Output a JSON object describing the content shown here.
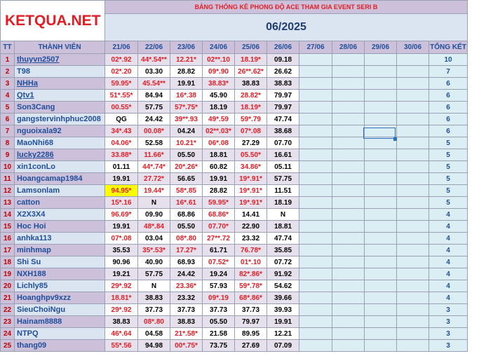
{
  "logo": "KETQUA.NET",
  "title": "BẢNG THỐNG KÊ PHONG ĐỘ ACE THAM GIA EVENT SERI B",
  "period": "06/2025",
  "headers": {
    "tt": "TT",
    "member": "THÀNH VIÊN",
    "dates": [
      "21/06",
      "22/06",
      "23/06",
      "24/06",
      "25/06",
      "26/06",
      "27/06",
      "28/06",
      "29/06",
      "30/06"
    ],
    "total": "TỔNG KẾT"
  },
  "rows": [
    {
      "tt": "1",
      "name": "thuyvn2507",
      "cells": [
        "02*.92",
        "44*.54**",
        "12.21*",
        "02**.10",
        "18.19*",
        "09.18"
      ],
      "total": "10"
    },
    {
      "tt": "2",
      "name": "T98",
      "cells": [
        "02*.20",
        "03.30",
        "28.82",
        "09*.90",
        "26**.62*",
        "26.62"
      ],
      "total": "7"
    },
    {
      "tt": "3",
      "name": "NHHa",
      "cells": [
        "59.95*",
        "45.54**",
        "19.91",
        "38.83*",
        "38.83",
        "38.83"
      ],
      "total": "6"
    },
    {
      "tt": "4",
      "name": "Qtv1",
      "cells": [
        "51*.55*",
        "84.94",
        "16*.38",
        "45.90",
        "28.82*",
        "79.97"
      ],
      "total": "6"
    },
    {
      "tt": "5",
      "name": "Son3Cang",
      "cells": [
        "00.55*",
        "57.75",
        "57*.75*",
        "18.19",
        "18.19*",
        "79.97"
      ],
      "total": "6"
    },
    {
      "tt": "6",
      "name": "gangstervinhphuc2008",
      "cells": [
        "QG",
        "24.42",
        "39**.93",
        "49*.59",
        "59*.79",
        "47.74"
      ],
      "total": "6"
    },
    {
      "tt": "7",
      "name": "nguoixala92",
      "cells": [
        "34*.43",
        "00.08*",
        "04.24",
        "02**.03*",
        "07*.08",
        "38.68"
      ],
      "total": "6"
    },
    {
      "tt": "8",
      "name": "MaoNhi68",
      "cells": [
        "04.06*",
        "52.58",
        "10.21*",
        "06*.08",
        "27.29",
        "07.70"
      ],
      "total": "5"
    },
    {
      "tt": "9",
      "name": "lucky2286",
      "cells": [
        "33.88*",
        "11.66*",
        "05.50",
        "18.81",
        "05.50*",
        "16.61"
      ],
      "total": "5"
    },
    {
      "tt": "10",
      "name": "xin1conLo",
      "cells": [
        "01.11",
        "44*.74*",
        "20*.26*",
        "60.82",
        "34.86*",
        "05.11"
      ],
      "total": "5"
    },
    {
      "tt": "11",
      "name": "Hoangcamap1984",
      "cells": [
        "19.91",
        "27.72*",
        "56.65",
        "19.91",
        "19*.91*",
        "57.75"
      ],
      "total": "5"
    },
    {
      "tt": "12",
      "name": "Lamsonlam",
      "cells": [
        "94.95*",
        "19.44*",
        "58*.85",
        "28.82",
        "19*.91*",
        "11.51"
      ],
      "total": "5"
    },
    {
      "tt": "13",
      "name": "catton",
      "cells": [
        "15*.16",
        "N",
        "16*.61",
        "59.95*",
        "19*.91*",
        "18.19"
      ],
      "total": "5"
    },
    {
      "tt": "14",
      "name": "X2X3X4",
      "cells": [
        "96.69*",
        "09.90",
        "68.86",
        "68.86*",
        "14.41",
        "N"
      ],
      "total": "4"
    },
    {
      "tt": "15",
      "name": "Hoc Hoi",
      "cells": [
        "19.91",
        "48*.84",
        "05.50",
        "07.70*",
        "22.90",
        "18.81"
      ],
      "total": "4"
    },
    {
      "tt": "16",
      "name": "anhka113",
      "cells": [
        "07*.08",
        "03.04",
        "08*.80",
        "27**.72",
        "23.32",
        "47.74"
      ],
      "total": "4"
    },
    {
      "tt": "17",
      "name": "minhmap",
      "cells": [
        "35.53",
        "35*.53*",
        "17.27*",
        "61.71",
        "76.78*",
        "35.85"
      ],
      "total": "4"
    },
    {
      "tt": "18",
      "name": "Shi Su",
      "cells": [
        "90.96",
        "40.90",
        "68.93",
        "07.52*",
        "01*.10",
        "07.72"
      ],
      "total": "4"
    },
    {
      "tt": "19",
      "name": "NXH188",
      "cells": [
        "19.21",
        "57.75",
        "24.42",
        "19.24",
        "82*.86*",
        "91.92"
      ],
      "total": "4"
    },
    {
      "tt": "20",
      "name": "Lichly85",
      "cells": [
        "29*.92",
        "N",
        "23.36*",
        "57.93",
        "59*.78*",
        "54.62"
      ],
      "total": "4"
    },
    {
      "tt": "21",
      "name": "Hoanghpv9xzz",
      "cells": [
        "18.81*",
        "38.83",
        "23.32",
        "09*.19",
        "68*.86*",
        "39.66"
      ],
      "total": "4"
    },
    {
      "tt": "22",
      "name": "SieuChoiNgu",
      "cells": [
        "29*.92",
        "37.73",
        "37.73",
        "37.73",
        "37.73",
        "39.93"
      ],
      "total": "3"
    },
    {
      "tt": "23",
      "name": "Hainam8888",
      "cells": [
        "38.83",
        "08*.80",
        "38.83",
        "05.50",
        "79.97",
        "19.91"
      ],
      "total": "3"
    },
    {
      "tt": "24",
      "name": "NTPQ",
      "cells": [
        "46*.64",
        "04.58",
        "21*.58*",
        "21.58",
        "89.95",
        "12.21"
      ],
      "total": "3"
    },
    {
      "tt": "25",
      "name": "thang09",
      "cells": [
        "55*.56",
        "94.98",
        "00*.75*",
        "73.75",
        "27.69",
        "07.09"
      ],
      "total": "3"
    }
  ]
}
